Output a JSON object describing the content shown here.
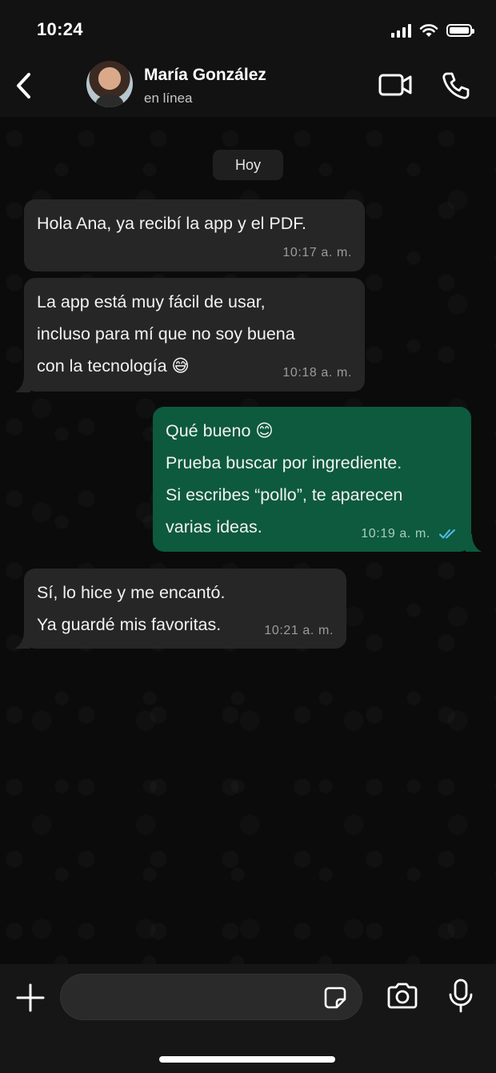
{
  "status_bar": {
    "time": "10:24"
  },
  "header": {
    "contact_name": "María González",
    "contact_status": "en línea"
  },
  "chat": {
    "date_label": "Hoy",
    "messages": [
      {
        "direction": "in",
        "text": "Hola Ana, ya recibí la app y el PDF.",
        "time": "10:17 a. m."
      },
      {
        "direction": "in",
        "text_lines": [
          "La app está muy fácil de usar,",
          "incluso para mí que no soy buena",
          "con la tecnología 😅"
        ],
        "time": "10:18 a. m."
      },
      {
        "direction": "out",
        "text_lines": [
          "Qué bueno 😊",
          "Prueba buscar por ingrediente.",
          "Si escribes “pollo”, te aparecen",
          "varias ideas."
        ],
        "time": "10:19 a. m.",
        "status": "read"
      },
      {
        "direction": "in",
        "text_lines": [
          "Sí, lo hice y me encantó.",
          "Ya guardé mis favoritas."
        ],
        "time": "10:21 a. m."
      }
    ]
  },
  "composer": {
    "placeholder": ""
  },
  "colors": {
    "outgoing": "#0d5a3e",
    "incoming": "#262626",
    "read_ticks": "#53bdeb"
  },
  "icons": [
    "back-chevron-icon",
    "video-call-icon",
    "phone-icon",
    "plus-icon",
    "sticker-icon",
    "camera-icon",
    "mic-icon"
  ]
}
